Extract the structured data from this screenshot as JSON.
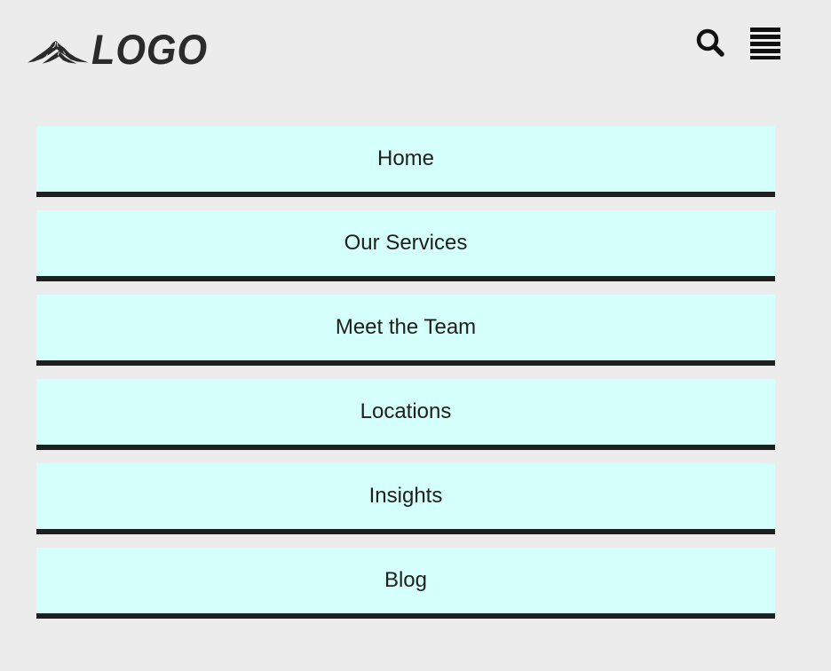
{
  "header": {
    "logo_text": "LOGO",
    "logo_icon": "mountain-logo-icon",
    "search_icon": "search-icon",
    "menu_icon": "hamburger-menu-icon"
  },
  "nav": {
    "items": [
      {
        "label": "Home"
      },
      {
        "label": "Our Services"
      },
      {
        "label": "Meet the Team"
      },
      {
        "label": "Locations"
      },
      {
        "label": "Insights"
      },
      {
        "label": "Blog"
      }
    ]
  },
  "colors": {
    "background": "#ececec",
    "nav_item_bg": "#d4fffa",
    "nav_item_border": "#1f1f1f",
    "text": "#1f1f1f",
    "logo": "#2b2b2b"
  }
}
